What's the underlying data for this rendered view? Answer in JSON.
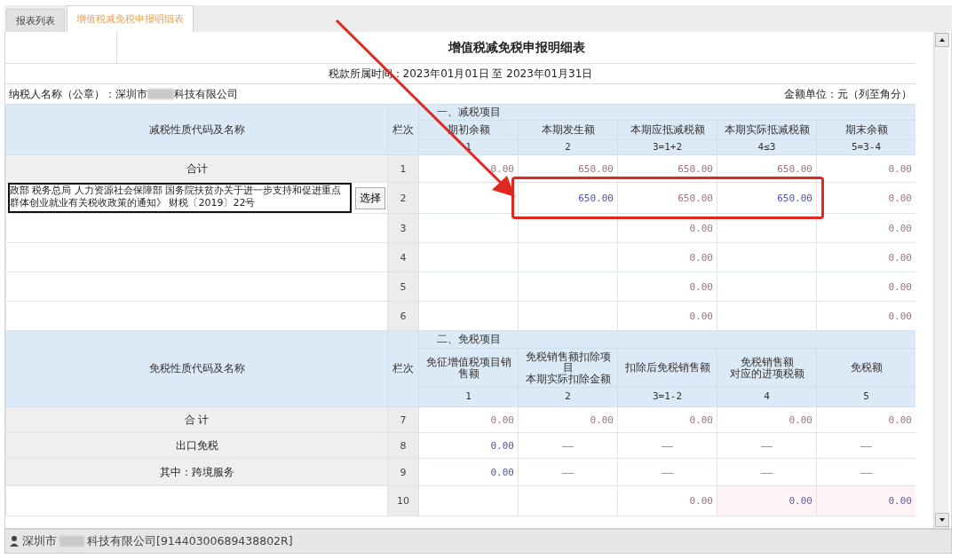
{
  "tabs": [
    {
      "label": "报表列表",
      "selected": false
    },
    {
      "label": "增值税减免税申报明细表",
      "selected": true
    }
  ],
  "form": {
    "title": "增值税减免税申报明细表",
    "period": "税款所属时间：2023年01月01日 至 2023年01月31日",
    "taxpayer_label": "纳税人名称（公章）：深圳市",
    "taxpayer_suffix": "科技有限公司",
    "unit": "金额单位：元（列至角分）"
  },
  "sections": [
    {
      "section": "一、减税项目",
      "name_header": "减税性质代码及名称",
      "index_header": "栏次",
      "columns": [
        {
          "lines": [
            "期初余额"
          ],
          "formula": "1"
        },
        {
          "lines": [
            "本期发生额"
          ],
          "formula": "2"
        },
        {
          "lines": [
            "本期应抵减税额"
          ],
          "formula": "3=1+2"
        },
        {
          "lines": [
            "本期实际抵减税额"
          ],
          "formula": "4≤3"
        },
        {
          "lines": [
            "期末余额"
          ],
          "formula": "5=3-4"
        }
      ],
      "rows": [
        {
          "kind": "label",
          "name": "合计",
          "index": "1",
          "cells": [
            {
              "kind": "calc",
              "value": "0.00"
            },
            {
              "kind": "calc",
              "value": "650.00"
            },
            {
              "kind": "calc",
              "value": "650.00"
            },
            {
              "kind": "calc",
              "value": "650.00"
            },
            {
              "kind": "calc",
              "value": "0.00"
            }
          ]
        },
        {
          "kind": "field",
          "name": "政部 税务总局 人力资源社会保障部 国务院扶贫办关于进一步支持和促进重点群体创业就业有关税收政策的通知》 财税〔2019〕22号",
          "button": "选择",
          "index": "2",
          "cells": [
            {
              "kind": "blank"
            },
            {
              "kind": "input",
              "value": "650.00"
            },
            {
              "kind": "calc",
              "value": "650.00"
            },
            {
              "kind": "input",
              "value": "650.00"
            },
            {
              "kind": "calc",
              "value": "0.00"
            }
          ]
        },
        {
          "kind": "empty",
          "index": "3",
          "cells": [
            {
              "kind": "blank"
            },
            {
              "kind": "blank"
            },
            {
              "kind": "calc",
              "value": "0.00"
            },
            {
              "kind": "blank"
            },
            {
              "kind": "calc",
              "value": "0.00"
            }
          ]
        },
        {
          "kind": "empty",
          "index": "4",
          "cells": [
            {
              "kind": "blank"
            },
            {
              "kind": "blank"
            },
            {
              "kind": "calc",
              "value": "0.00"
            },
            {
              "kind": "blank"
            },
            {
              "kind": "calc",
              "value": "0.00"
            }
          ]
        },
        {
          "kind": "empty",
          "index": "5",
          "cells": [
            {
              "kind": "blank"
            },
            {
              "kind": "blank"
            },
            {
              "kind": "calc",
              "value": "0.00"
            },
            {
              "kind": "blank"
            },
            {
              "kind": "calc",
              "value": "0.00"
            }
          ]
        },
        {
          "kind": "empty",
          "index": "6",
          "cells": [
            {
              "kind": "blank"
            },
            {
              "kind": "blank"
            },
            {
              "kind": "calc",
              "value": "0.00"
            },
            {
              "kind": "blank"
            },
            {
              "kind": "calc",
              "value": "0.00"
            }
          ]
        }
      ]
    },
    {
      "section": "二、免税项目",
      "name_header": "免税性质代码及名称",
      "index_header": "栏次",
      "columns": [
        {
          "lines": [
            "免征增值税项目销售额"
          ],
          "formula": "1"
        },
        {
          "lines": [
            "免税销售额扣除项目",
            "本期实际扣除金额"
          ],
          "formula": "2"
        },
        {
          "lines": [
            "扣除后免税销售额"
          ],
          "formula": "3=1-2"
        },
        {
          "lines": [
            "免税销售额",
            "对应的进项税额"
          ],
          "formula": "4"
        },
        {
          "lines": [
            "免税额"
          ],
          "formula": "5"
        }
      ],
      "rows": [
        {
          "kind": "label",
          "name": "合 计",
          "index": "7",
          "cells": [
            {
              "kind": "calc",
              "value": "0.00"
            },
            {
              "kind": "calc",
              "value": "0.00"
            },
            {
              "kind": "calc",
              "value": "0.00"
            },
            {
              "kind": "calc",
              "value": "0.00"
            },
            {
              "kind": "calc",
              "value": "0.00"
            }
          ]
        },
        {
          "kind": "label",
          "name": "出口免税",
          "index": "8",
          "cells": [
            {
              "kind": "input",
              "value": "0.00"
            },
            {
              "kind": "dash",
              "value": "——"
            },
            {
              "kind": "dash",
              "value": "——"
            },
            {
              "kind": "dash",
              "value": "——"
            },
            {
              "kind": "dash",
              "value": "——"
            }
          ]
        },
        {
          "kind": "label",
          "name": "其中：跨境服务",
          "index": "9",
          "cells": [
            {
              "kind": "input",
              "value": "0.00"
            },
            {
              "kind": "dash",
              "value": "——"
            },
            {
              "kind": "dash",
              "value": "——"
            },
            {
              "kind": "dash",
              "value": "——"
            },
            {
              "kind": "dash",
              "value": "——"
            }
          ]
        },
        {
          "kind": "empty",
          "index": "10",
          "cells": [
            {
              "kind": "blank"
            },
            {
              "kind": "blank"
            },
            {
              "kind": "calc",
              "value": "0.00"
            },
            {
              "kind": "editable",
              "value": "0.00"
            },
            {
              "kind": "editable",
              "value": "0.00"
            }
          ]
        }
      ]
    }
  ],
  "status_bar": {
    "company_prefix": "深圳市",
    "company_suffix": "科技有限公司[91440300689438802R]"
  },
  "annotation": {
    "arrow": true,
    "highlight_box": true
  }
}
